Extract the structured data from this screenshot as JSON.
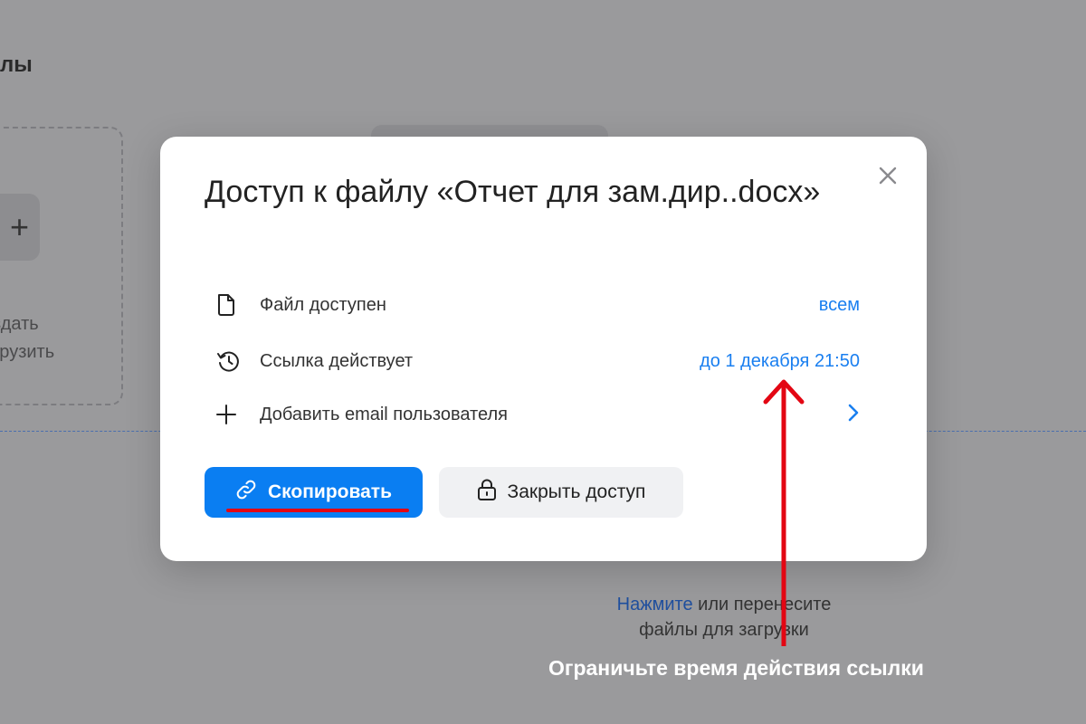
{
  "background": {
    "title_fragment": "лы",
    "create_line1": "здать",
    "create_line2": "грузить",
    "plus_icon": "plus-icon",
    "drop_hint_link": "Нажмите",
    "drop_hint_rest": " или перенесите",
    "drop_hint_line2": "файлы для загрузки"
  },
  "modal": {
    "title": "Доступ к файлу «Отчет для зам.дир..docx»",
    "close_icon": "close-icon",
    "rows": [
      {
        "icon": "file-icon",
        "label": "Файл доступен",
        "value": "всем"
      },
      {
        "icon": "history-icon",
        "label": "Ссылка действует",
        "value": "до 1 декабря 21:50"
      },
      {
        "icon": "plus-icon",
        "label": "Добавить email пользователя",
        "value_icon": "chevron-right-icon"
      }
    ],
    "buttons": {
      "copy": {
        "label": "Скопировать",
        "icon": "link-icon"
      },
      "close_access": {
        "label": "Закрыть доступ",
        "icon": "lock-icon"
      }
    }
  },
  "annotation": {
    "caption": "Ограничьте время действия ссылки",
    "color": "#e30613"
  },
  "colors": {
    "accent": "#0a7ef2",
    "link": "#1a7ff0",
    "overlay": "#9a9a9c"
  }
}
